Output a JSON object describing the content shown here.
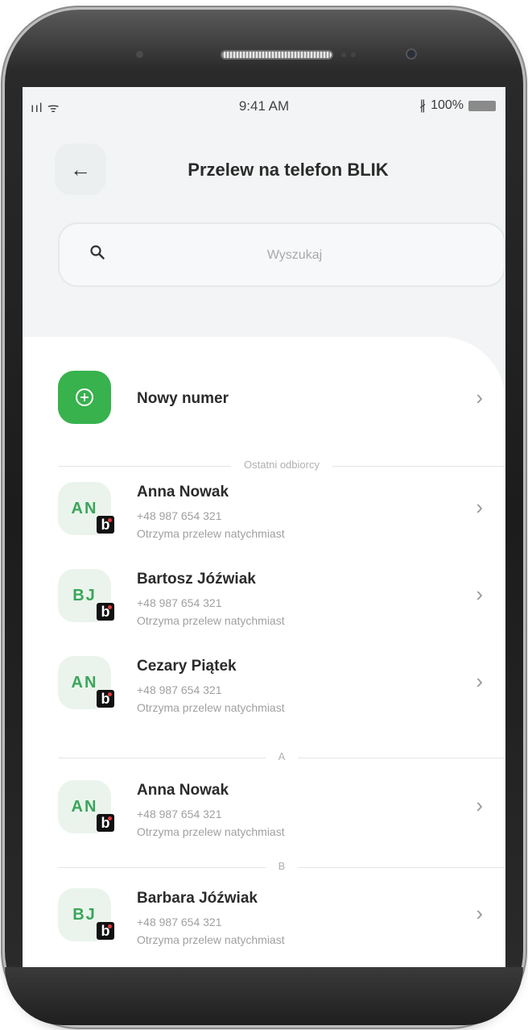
{
  "status_bar": {
    "signal": "ııl ᯤ",
    "time": "9:41 AM",
    "bluetooth": "∦",
    "battery": "100%"
  },
  "header": {
    "back_icon": "←",
    "title": "Przelew na telefon BLIK"
  },
  "search": {
    "placeholder": "Wyszukaj"
  },
  "new_number": {
    "label": "Nowy numer"
  },
  "sections": [
    {
      "label": "Ostatni odbiorcy",
      "contacts": [
        {
          "initials": "AN",
          "name": "Anna Nowak",
          "phone": "+48 987 654 321",
          "note": "Otrzyma przelew natychmiast"
        },
        {
          "initials": "BJ",
          "name": "Bartosz Jóźwiak",
          "phone": "+48 987 654 321",
          "note": "Otrzyma przelew natychmiast"
        },
        {
          "initials": "AN",
          "name": "Cezary Piątek",
          "phone": "+48 987 654 321",
          "note": "Otrzyma przelew natychmiast"
        }
      ]
    },
    {
      "label": "A",
      "contacts": [
        {
          "initials": "AN",
          "name": "Anna Nowak",
          "phone": "+48 987 654 321",
          "note": "Otrzyma przelew natychmiast"
        }
      ]
    },
    {
      "label": "B",
      "contacts": [
        {
          "initials": "BJ",
          "name": "Barbara Jóźwiak",
          "phone": "+48 987 654 321",
          "note": "Otrzyma przelew natychmiast"
        }
      ]
    }
  ],
  "badge_letter": "b",
  "chevron": "›",
  "colors": {
    "accent_green": "#37b24d",
    "initials_green": "#3aa55a",
    "header_bg": "#f2f4f5"
  }
}
